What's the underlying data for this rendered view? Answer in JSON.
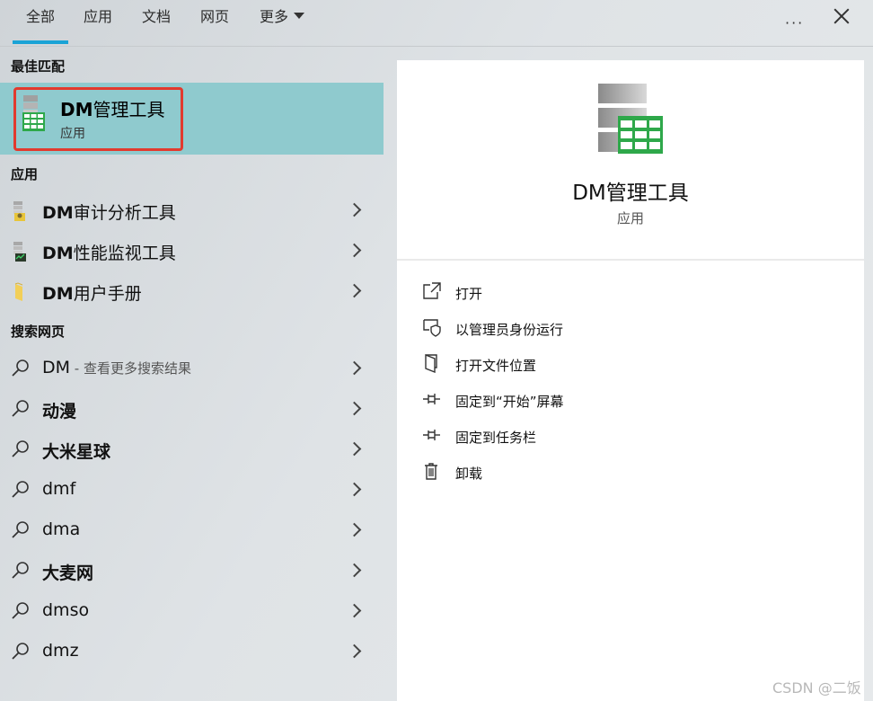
{
  "tabs": [
    {
      "label": "全部",
      "active": true
    },
    {
      "label": "应用",
      "active": false
    },
    {
      "label": "文档",
      "active": false
    },
    {
      "label": "网页",
      "active": false
    },
    {
      "label": "更多",
      "active": false
    }
  ],
  "menu_dots": "···",
  "sections": {
    "best_match": "最佳匹配",
    "apps": "应用",
    "web_search": "搜索网页"
  },
  "best_match": {
    "title_prefix": "DM",
    "title_rest": "管理工具",
    "subtitle": "应用"
  },
  "apps": [
    {
      "prefix": "DM",
      "rest": "审计分析工具",
      "icon": "audit-tool-icon"
    },
    {
      "prefix": "DM",
      "rest": "性能监视工具",
      "icon": "monitor-tool-icon"
    },
    {
      "prefix": "DM",
      "rest": "用户手册",
      "icon": "folder-icon"
    }
  ],
  "web_results": [
    {
      "label": "DM",
      "suffix": " - 查看更多搜索结果"
    },
    {
      "label": "动漫"
    },
    {
      "label": "大米星球"
    },
    {
      "label": "dmf"
    },
    {
      "label": "dma"
    },
    {
      "label": "大麦网"
    },
    {
      "label": "dmso"
    },
    {
      "label": "dmz"
    }
  ],
  "detail": {
    "title": "DM管理工具",
    "subtitle": "应用",
    "actions": [
      {
        "label": "打开",
        "icon": "open-icon"
      },
      {
        "label": "以管理员身份运行",
        "icon": "admin-shield-icon"
      },
      {
        "label": "打开文件位置",
        "icon": "file-location-icon"
      },
      {
        "label": "固定到“开始”屏幕",
        "icon": "pin-icon"
      },
      {
        "label": "固定到任务栏",
        "icon": "pin-icon"
      },
      {
        "label": "卸载",
        "icon": "trash-icon"
      }
    ]
  },
  "watermark": "CSDN @二饭",
  "colors": {
    "accent": "#1aa3d6",
    "selected_row": "#8fcace",
    "highlight_box": "#e23a2e"
  }
}
